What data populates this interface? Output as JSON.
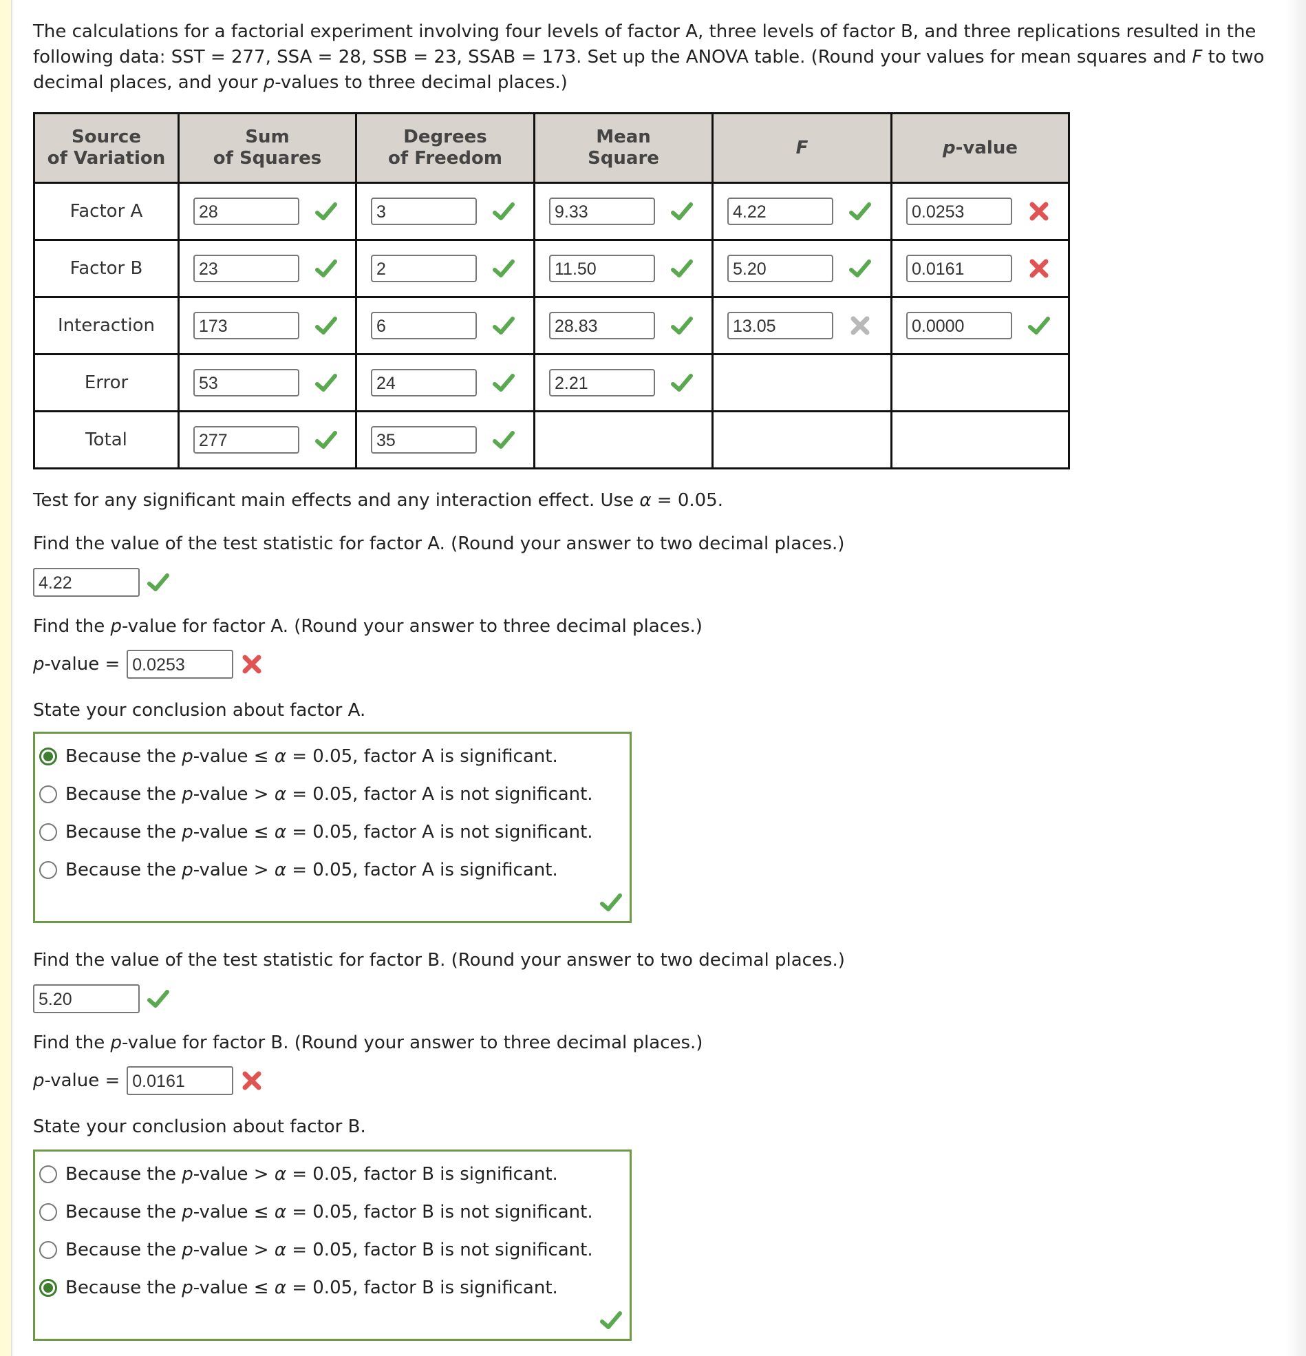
{
  "intro": {
    "line1": "The calculations for a factorial experiment involving four levels of factor A, three levels of factor B, and three replications resulted in the",
    "line2_a": "following data: SST = 277, SSA = 28, SSB = 23, SSAB = 173. Set up the ANOVA table. (Round your values for mean squares and ",
    "line2_f": "F",
    "line2_b": " to two",
    "line3_a": "decimal places, and your ",
    "line3_p": "p",
    "line3_b": "-values to three decimal places.)"
  },
  "table": {
    "headers": {
      "source_1": "Source",
      "source_2": "of Variation",
      "ss_1": "Sum",
      "ss_2": "of Squares",
      "df_1": "Degrees",
      "df_2": "of Freedom",
      "ms_1": "Mean",
      "ms_2": "Square",
      "f": "F",
      "p_italic": "p",
      "p_rest": "-value"
    },
    "rows": [
      {
        "source": "Factor A",
        "ss": "28",
        "ss_status": "correct",
        "df": "3",
        "df_status": "correct",
        "ms": "9.33",
        "ms_status": "correct",
        "f": "4.22",
        "f_status": "correct",
        "p": "0.0253",
        "p_status": "incorrect"
      },
      {
        "source": "Factor B",
        "ss": "23",
        "ss_status": "correct",
        "df": "2",
        "df_status": "correct",
        "ms": "11.50",
        "ms_status": "correct",
        "f": "5.20",
        "f_status": "correct",
        "p": "0.0161",
        "p_status": "incorrect"
      },
      {
        "source": "Interaction",
        "ss": "173",
        "ss_status": "correct",
        "df": "6",
        "df_status": "correct",
        "ms": "28.83",
        "ms_status": "correct",
        "f": "13.05",
        "f_status": "unanswered-incorrect",
        "p": "0.0000",
        "p_status": "correct"
      },
      {
        "source": "Error",
        "ss": "53",
        "ss_status": "correct",
        "df": "24",
        "df_status": "correct",
        "ms": "2.21",
        "ms_status": "correct"
      },
      {
        "source": "Total",
        "ss": "277",
        "ss_status": "correct",
        "df": "35",
        "df_status": "correct"
      }
    ]
  },
  "test_instruction": {
    "a": "Test for any significant main effects and any interaction effect. Use ",
    "alpha": "α",
    "b": " = 0.05."
  },
  "factor_a": {
    "stat_question": "Find the value of the test statistic for factor A. (Round your answer to two decimal places.)",
    "stat_value": "4.22",
    "p_question_a": "Find the ",
    "p_question_p": "p",
    "p_question_b": "-value for factor A. (Round your answer to three decimal places.)",
    "p_label_p": "p",
    "p_label_rest": "-value =",
    "p_value": "0.0253",
    "conclusion_prompt": "State your conclusion about factor A.",
    "choices": [
      {
        "pre": "Because the ",
        "p": "p",
        "post": "-value ≤ ",
        "alpha": "α",
        "end": " = 0.05, factor A is significant.",
        "selected": true
      },
      {
        "pre": "Because the ",
        "p": "p",
        "post": "-value > ",
        "alpha": "α",
        "end": " = 0.05, factor A is not significant.",
        "selected": false
      },
      {
        "pre": "Because the ",
        "p": "p",
        "post": "-value ≤ ",
        "alpha": "α",
        "end": " = 0.05, factor A is not significant.",
        "selected": false
      },
      {
        "pre": "Because the ",
        "p": "p",
        "post": "-value > ",
        "alpha": "α",
        "end": " = 0.05, factor A is significant.",
        "selected": false
      }
    ]
  },
  "factor_b": {
    "stat_question": "Find the value of the test statistic for factor B. (Round your answer to two decimal places.)",
    "stat_value": "5.20",
    "p_question_a": "Find the ",
    "p_question_p": "p",
    "p_question_b": "-value for factor B. (Round your answer to three decimal places.)",
    "p_label_p": "p",
    "p_label_rest": "-value =",
    "p_value": "0.0161",
    "conclusion_prompt": "State your conclusion about factor B.",
    "choices": [
      {
        "pre": "Because the ",
        "p": "p",
        "post": "-value > ",
        "alpha": "α",
        "end": " = 0.05, factor B is significant.",
        "selected": false
      },
      {
        "pre": "Because the ",
        "p": "p",
        "post": "-value ≤ ",
        "alpha": "α",
        "end": " = 0.05, factor B is not significant.",
        "selected": false
      },
      {
        "pre": "Because the ",
        "p": "p",
        "post": "-value > ",
        "alpha": "α",
        "end": " = 0.05, factor B is not significant.",
        "selected": false
      },
      {
        "pre": "Because the ",
        "p": "p",
        "post": "-value ≤ ",
        "alpha": "α",
        "end": " = 0.05, factor B is significant.",
        "selected": true
      }
    ]
  },
  "colors": {
    "correct": "#5aa84f",
    "incorrect": "#e05353",
    "neutral_incorrect": "#b8b8b8",
    "choice_border": "#6e9a48",
    "header_bg": "#d8d4cd"
  }
}
